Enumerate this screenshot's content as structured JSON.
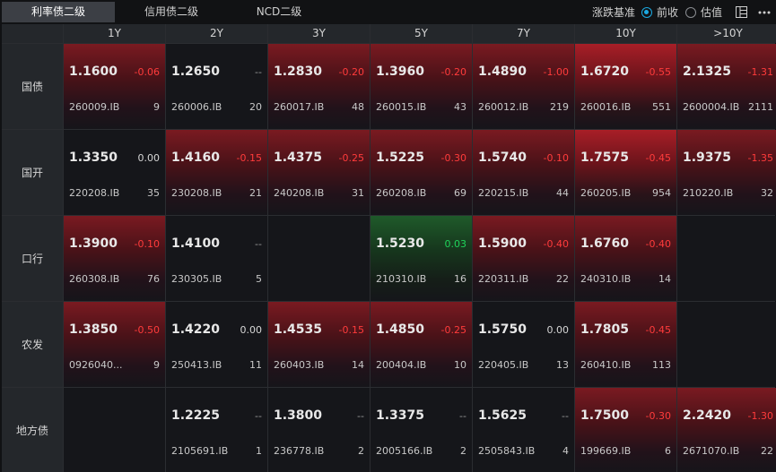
{
  "tabs": [
    {
      "label": "利率债二级",
      "active": true
    },
    {
      "label": "信用债二级",
      "active": false
    },
    {
      "label": "NCD二级",
      "active": false
    }
  ],
  "controls": {
    "basis_label": "涨跌基准",
    "options": [
      {
        "label": "前收",
        "selected": true
      },
      {
        "label": "估值",
        "selected": false
      }
    ],
    "icons": [
      "layout-icon",
      "more-icon"
    ]
  },
  "columns": [
    "1Y",
    "2Y",
    "3Y",
    "5Y",
    "7Y",
    "10Y",
    ">10Y"
  ],
  "rows": [
    {
      "label": "国债",
      "cells": [
        {
          "price": "1.1600",
          "change": "-0.06",
          "code": "260009.IB",
          "count": "9",
          "tone": "red"
        },
        {
          "price": "1.2650",
          "change": "--",
          "code": "260006.IB",
          "count": "20",
          "tone": "none"
        },
        {
          "price": "1.2830",
          "change": "-0.20",
          "code": "260017.IB",
          "count": "48",
          "tone": "red"
        },
        {
          "price": "1.3960",
          "change": "-0.20",
          "code": "260015.IB",
          "count": "43",
          "tone": "red"
        },
        {
          "price": "1.4890",
          "change": "-1.00",
          "code": "260012.IB",
          "count": "219",
          "tone": "red"
        },
        {
          "price": "1.6720",
          "change": "-0.55",
          "code": "260016.IB",
          "count": "551",
          "tone": "red-strong"
        },
        {
          "price": "2.1325",
          "change": "-1.31",
          "code": "2600004.IB",
          "count": "2111",
          "tone": "red"
        }
      ]
    },
    {
      "label": "国开",
      "cells": [
        {
          "price": "1.3350",
          "change": "0.00",
          "code": "220208.IB",
          "count": "35",
          "tone": "none"
        },
        {
          "price": "1.4160",
          "change": "-0.15",
          "code": "230208.IB",
          "count": "21",
          "tone": "red"
        },
        {
          "price": "1.4375",
          "change": "-0.25",
          "code": "240208.IB",
          "count": "31",
          "tone": "red"
        },
        {
          "price": "1.5225",
          "change": "-0.30",
          "code": "260208.IB",
          "count": "69",
          "tone": "red"
        },
        {
          "price": "1.5740",
          "change": "-0.10",
          "code": "220215.IB",
          "count": "44",
          "tone": "red"
        },
        {
          "price": "1.7575",
          "change": "-0.45",
          "code": "260205.IB",
          "count": "954",
          "tone": "red-strong"
        },
        {
          "price": "1.9375",
          "change": "-1.35",
          "code": "210220.IB",
          "count": "32",
          "tone": "red"
        }
      ]
    },
    {
      "label": "口行",
      "cells": [
        {
          "price": "1.3900",
          "change": "-0.10",
          "code": "260308.IB",
          "count": "76",
          "tone": "red"
        },
        {
          "price": "1.4100",
          "change": "--",
          "code": "230305.IB",
          "count": "5",
          "tone": "none"
        },
        {
          "price": "",
          "change": "",
          "code": "",
          "count": "",
          "tone": "none"
        },
        {
          "price": "1.5230",
          "change": "0.03",
          "code": "210310.IB",
          "count": "16",
          "tone": "green"
        },
        {
          "price": "1.5900",
          "change": "-0.40",
          "code": "220311.IB",
          "count": "22",
          "tone": "red"
        },
        {
          "price": "1.6760",
          "change": "-0.40",
          "code": "240310.IB",
          "count": "14",
          "tone": "red"
        },
        {
          "price": "",
          "change": "",
          "code": "",
          "count": "",
          "tone": "none"
        }
      ]
    },
    {
      "label": "农发",
      "cells": [
        {
          "price": "1.3850",
          "change": "-0.50",
          "code": "0926040...",
          "count": "9",
          "tone": "red"
        },
        {
          "price": "1.4220",
          "change": "0.00",
          "code": "250413.IB",
          "count": "11",
          "tone": "none"
        },
        {
          "price": "1.4535",
          "change": "-0.15",
          "code": "260403.IB",
          "count": "14",
          "tone": "red"
        },
        {
          "price": "1.4850",
          "change": "-0.25",
          "code": "200404.IB",
          "count": "10",
          "tone": "red"
        },
        {
          "price": "1.5750",
          "change": "0.00",
          "code": "220405.IB",
          "count": "13",
          "tone": "none"
        },
        {
          "price": "1.7805",
          "change": "-0.45",
          "code": "260410.IB",
          "count": "113",
          "tone": "red"
        },
        {
          "price": "",
          "change": "",
          "code": "",
          "count": "",
          "tone": "none"
        }
      ]
    },
    {
      "label": "地方债",
      "cells": [
        {
          "price": "",
          "change": "",
          "code": "",
          "count": "",
          "tone": "none"
        },
        {
          "price": "1.2225",
          "change": "--",
          "code": "2105691.IB",
          "count": "1",
          "tone": "none"
        },
        {
          "price": "1.3800",
          "change": "--",
          "code": "236778.IB",
          "count": "2",
          "tone": "none"
        },
        {
          "price": "1.3375",
          "change": "--",
          "code": "2005166.IB",
          "count": "2",
          "tone": "none"
        },
        {
          "price": "1.5625",
          "change": "--",
          "code": "2505843.IB",
          "count": "4",
          "tone": "none"
        },
        {
          "price": "1.7500",
          "change": "-0.30",
          "code": "199669.IB",
          "count": "6",
          "tone": "red"
        },
        {
          "price": "2.2420",
          "change": "-1.30",
          "code": "2671070.IB",
          "count": "22",
          "tone": "red"
        }
      ]
    }
  ],
  "colors": {
    "negative": "#ff3b3b",
    "positive": "#1fd25a",
    "accent": "#1ba9e1",
    "background": "#101114"
  }
}
